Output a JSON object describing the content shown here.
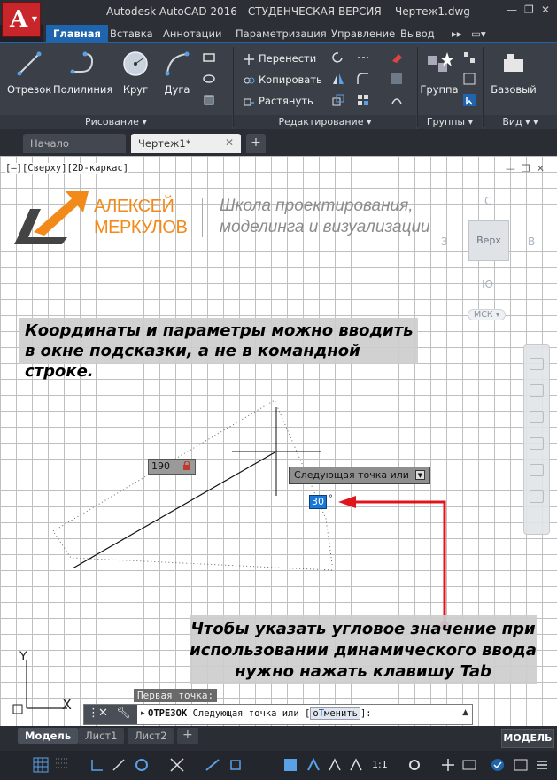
{
  "app": {
    "title": "Autodesk AutoCAD 2016 - СТУДЕНЧЕСКАЯ ВЕРСИЯ",
    "file": "Чертеж1.dwg",
    "logo_letter": "A"
  },
  "ribbon_tabs": [
    "Главная",
    "Вставка",
    "Аннотации",
    "Параметризация",
    "Управление",
    "Вывод"
  ],
  "ribbon": {
    "draw": {
      "title": "Рисование ▾",
      "line": "Отрезок",
      "polyline": "Полилиния",
      "circle": "Круг",
      "arc": "Дуга"
    },
    "modify": {
      "title": "Редактирование ▾",
      "move": "Перенести",
      "copy": "Копировать",
      "stretch": "Растянуть"
    },
    "groups": {
      "title": "Группы ▾",
      "group": "Группа"
    },
    "view": {
      "title": "Вид ▾",
      "base": "Базовый"
    }
  },
  "doc_tabs": {
    "start": "Начало",
    "drawing": "Чертеж1*"
  },
  "viewport": {
    "label": "[–][Сверху][2D-каркас]",
    "logo_name_1": "АЛЕКСЕЙ",
    "logo_name_2": "МЕРКУЛОВ",
    "logo_school_1": "Школа проектирования,",
    "logo_school_2": "моделинга и визуализации",
    "viewcube": {
      "north": "С",
      "south": "Ю",
      "west": "З",
      "east": "В",
      "face": "Верх",
      "ucs": "МСК"
    },
    "caption_top_1": "Координаты и параметры можно вводить",
    "caption_top_2": "в окне подсказки, а не в командной строке.",
    "caption_bottom_1": "Чтобы указать угловое значение при",
    "caption_bottom_2": "использовании динамического ввода",
    "caption_bottom_3": "нужно нажать клавишу Tab",
    "length_value": "190",
    "tooltip_text": "Следующая точка или",
    "angle_value": "30",
    "angle_unit": "°",
    "ucs_y": "Y",
    "ucs_x": "X",
    "first_point": "Первая точка:"
  },
  "command_line": {
    "command": "ОТРЕЗОК",
    "prompt": "Следующая точка или",
    "option_prefix": "о",
    "option_hot": "Т",
    "option_rest": "менить"
  },
  "layout_tabs": [
    "Модель",
    "Лист1",
    "Лист2"
  ],
  "model_button": "МОДЕЛЬ",
  "status": {
    "scale": "1:1"
  },
  "colors": {
    "accent": "#1f65ad",
    "logo_orange": "#f28a1a",
    "arrow_red": "#e0141b",
    "app_red": "#c8262a"
  }
}
